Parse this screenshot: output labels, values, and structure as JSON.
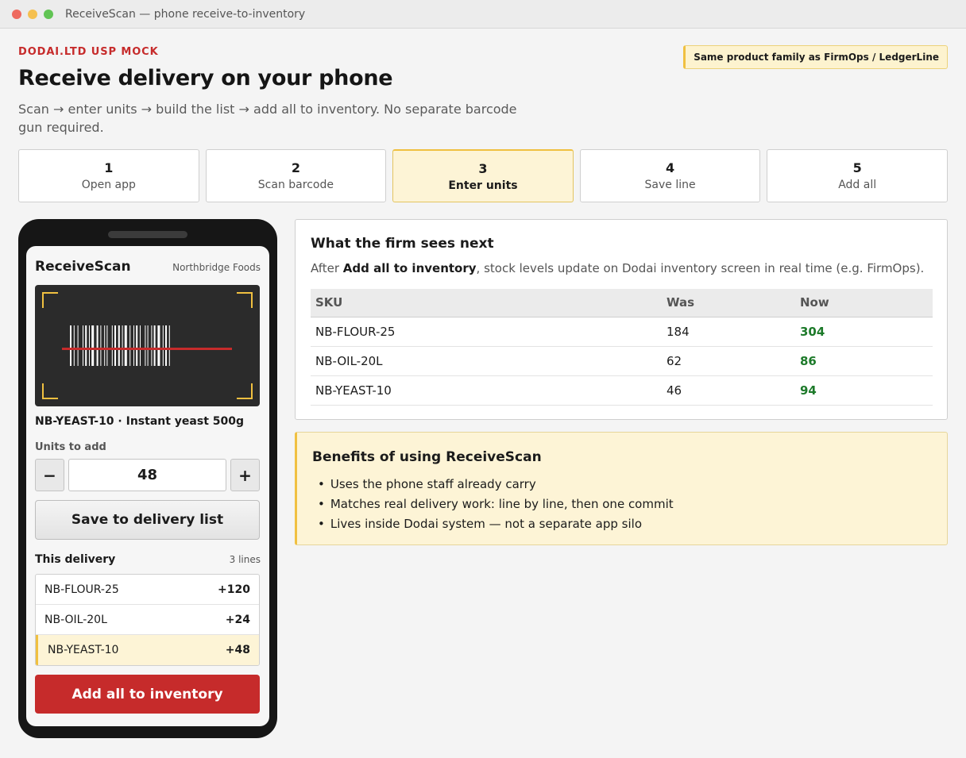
{
  "window": {
    "title": "ReceiveScan — phone receive-to-inventory"
  },
  "header": {
    "brand": "DODAI.LTD USP MOCK",
    "title": "Receive delivery on your phone",
    "subtitle": "Scan → enter units → build the list → add all to inventory. No separate barcode gun required.",
    "family_badge": "Same product family as FirmOps / LedgerLine"
  },
  "steps": [
    {
      "num": "1",
      "label": "Open app"
    },
    {
      "num": "2",
      "label": "Scan barcode"
    },
    {
      "num": "3",
      "label": "Enter units",
      "active": true
    },
    {
      "num": "4",
      "label": "Save line"
    },
    {
      "num": "5",
      "label": "Add all"
    }
  ],
  "phone": {
    "app_name": "ReceiveScan",
    "org": "Northbridge Foods",
    "product": "NB-YEAST-10 · Instant yeast 500g",
    "units_label": "Units to add",
    "decrement": "−",
    "increment": "+",
    "units_value": "48",
    "save_label": "Save to delivery list",
    "delivery_title": "This delivery",
    "delivery_count": "3 lines",
    "delivery": [
      {
        "sku": "NB-FLOUR-25",
        "qty": "+120"
      },
      {
        "sku": "NB-OIL-20L",
        "qty": "+24"
      },
      {
        "sku": "NB-YEAST-10",
        "qty": "+48",
        "highlight": true
      }
    ],
    "add_all_label": "Add all to inventory"
  },
  "firm_panel": {
    "title": "What the firm sees next",
    "desc_prefix": "After ",
    "desc_bold": "Add all to inventory",
    "desc_suffix": ", stock levels update on Dodai inventory screen in real time (e.g. FirmOps).",
    "columns": [
      "SKU",
      "Was",
      "Now"
    ],
    "rows": [
      [
        "NB-FLOUR-25",
        "184",
        "304"
      ],
      [
        "NB-OIL-20L",
        "62",
        "86"
      ],
      [
        "NB-YEAST-10",
        "46",
        "94"
      ]
    ]
  },
  "benefits": {
    "title": "Benefits of using ReceiveScan",
    "items": [
      "Uses the phone staff already carry",
      "Matches real delivery work: line by line, then one commit",
      "Lives inside Dodai system — not a separate app silo"
    ]
  },
  "colors": {
    "brand_red": "#c62b2b",
    "accent_yellow": "#f0c040",
    "highlight_bg": "#fdf4d6",
    "now_green": "#1d7a2a"
  }
}
